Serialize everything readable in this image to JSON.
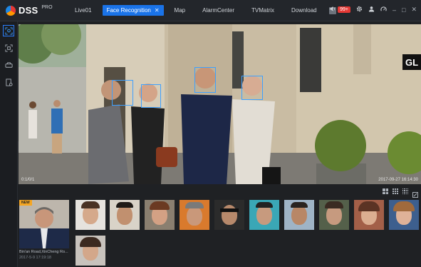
{
  "app": {
    "logo_text": "DSS",
    "logo_sup": "PRO"
  },
  "tabs": [
    {
      "label": "Live01",
      "active": false
    },
    {
      "label": "Face Recognition",
      "active": true
    },
    {
      "label": "Map",
      "active": false
    },
    {
      "label": "AlarmCenter",
      "active": false
    },
    {
      "label": "TVMatrix",
      "active": false
    },
    {
      "label": "Download",
      "active": false
    }
  ],
  "header": {
    "alarm_count": "99+",
    "icons": [
      "speaker-icon",
      "gear-icon",
      "user-icon",
      "gauge-icon",
      "minimize-icon",
      "maximize-icon",
      "close-icon"
    ]
  },
  "sidebar": {
    "items": [
      {
        "icon": "face-scan-icon",
        "active": true
      },
      {
        "icon": "capture-icon",
        "active": false
      },
      {
        "icon": "vehicle-icon",
        "active": false
      },
      {
        "icon": "report-icon",
        "active": false
      }
    ]
  },
  "video": {
    "overlay_left": "0:1/0/1",
    "overlay_right": "2017-09-27 16:14:30",
    "sign_text": "GL"
  },
  "snapshot": {
    "badge": "NEW",
    "location": "Bin'an Road,XinCheng Ro...",
    "time": "2017-5-9 17:19:18"
  },
  "colors": {
    "accent": "#1a73e8",
    "alarm": "#e53935",
    "new_badge": "#f5a623",
    "face_box": "#3da0ff"
  }
}
